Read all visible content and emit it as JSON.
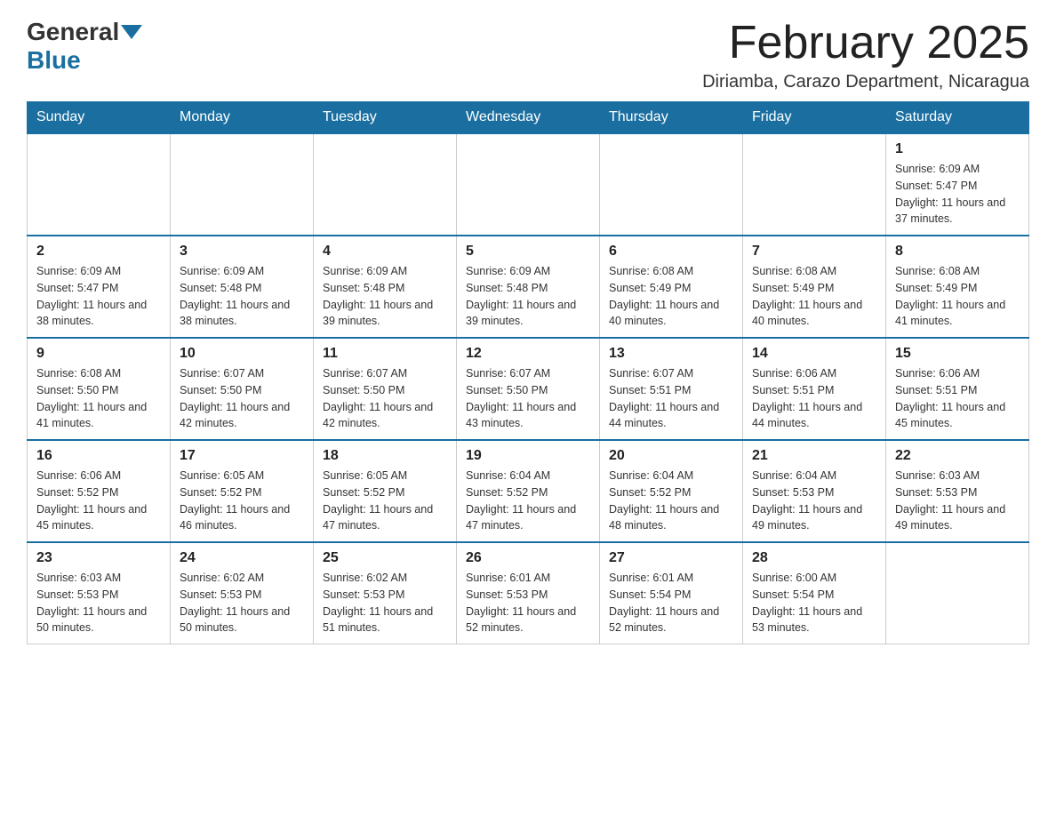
{
  "header": {
    "logo_general": "General",
    "logo_blue": "Blue",
    "month_title": "February 2025",
    "location": "Diriamba, Carazo Department, Nicaragua"
  },
  "days_of_week": [
    "Sunday",
    "Monday",
    "Tuesday",
    "Wednesday",
    "Thursday",
    "Friday",
    "Saturday"
  ],
  "weeks": [
    [
      {
        "day": "",
        "info": ""
      },
      {
        "day": "",
        "info": ""
      },
      {
        "day": "",
        "info": ""
      },
      {
        "day": "",
        "info": ""
      },
      {
        "day": "",
        "info": ""
      },
      {
        "day": "",
        "info": ""
      },
      {
        "day": "1",
        "info": "Sunrise: 6:09 AM\nSunset: 5:47 PM\nDaylight: 11 hours and 37 minutes."
      }
    ],
    [
      {
        "day": "2",
        "info": "Sunrise: 6:09 AM\nSunset: 5:47 PM\nDaylight: 11 hours and 38 minutes."
      },
      {
        "day": "3",
        "info": "Sunrise: 6:09 AM\nSunset: 5:48 PM\nDaylight: 11 hours and 38 minutes."
      },
      {
        "day": "4",
        "info": "Sunrise: 6:09 AM\nSunset: 5:48 PM\nDaylight: 11 hours and 39 minutes."
      },
      {
        "day": "5",
        "info": "Sunrise: 6:09 AM\nSunset: 5:48 PM\nDaylight: 11 hours and 39 minutes."
      },
      {
        "day": "6",
        "info": "Sunrise: 6:08 AM\nSunset: 5:49 PM\nDaylight: 11 hours and 40 minutes."
      },
      {
        "day": "7",
        "info": "Sunrise: 6:08 AM\nSunset: 5:49 PM\nDaylight: 11 hours and 40 minutes."
      },
      {
        "day": "8",
        "info": "Sunrise: 6:08 AM\nSunset: 5:49 PM\nDaylight: 11 hours and 41 minutes."
      }
    ],
    [
      {
        "day": "9",
        "info": "Sunrise: 6:08 AM\nSunset: 5:50 PM\nDaylight: 11 hours and 41 minutes."
      },
      {
        "day": "10",
        "info": "Sunrise: 6:07 AM\nSunset: 5:50 PM\nDaylight: 11 hours and 42 minutes."
      },
      {
        "day": "11",
        "info": "Sunrise: 6:07 AM\nSunset: 5:50 PM\nDaylight: 11 hours and 42 minutes."
      },
      {
        "day": "12",
        "info": "Sunrise: 6:07 AM\nSunset: 5:50 PM\nDaylight: 11 hours and 43 minutes."
      },
      {
        "day": "13",
        "info": "Sunrise: 6:07 AM\nSunset: 5:51 PM\nDaylight: 11 hours and 44 minutes."
      },
      {
        "day": "14",
        "info": "Sunrise: 6:06 AM\nSunset: 5:51 PM\nDaylight: 11 hours and 44 minutes."
      },
      {
        "day": "15",
        "info": "Sunrise: 6:06 AM\nSunset: 5:51 PM\nDaylight: 11 hours and 45 minutes."
      }
    ],
    [
      {
        "day": "16",
        "info": "Sunrise: 6:06 AM\nSunset: 5:52 PM\nDaylight: 11 hours and 45 minutes."
      },
      {
        "day": "17",
        "info": "Sunrise: 6:05 AM\nSunset: 5:52 PM\nDaylight: 11 hours and 46 minutes."
      },
      {
        "day": "18",
        "info": "Sunrise: 6:05 AM\nSunset: 5:52 PM\nDaylight: 11 hours and 47 minutes."
      },
      {
        "day": "19",
        "info": "Sunrise: 6:04 AM\nSunset: 5:52 PM\nDaylight: 11 hours and 47 minutes."
      },
      {
        "day": "20",
        "info": "Sunrise: 6:04 AM\nSunset: 5:52 PM\nDaylight: 11 hours and 48 minutes."
      },
      {
        "day": "21",
        "info": "Sunrise: 6:04 AM\nSunset: 5:53 PM\nDaylight: 11 hours and 49 minutes."
      },
      {
        "day": "22",
        "info": "Sunrise: 6:03 AM\nSunset: 5:53 PM\nDaylight: 11 hours and 49 minutes."
      }
    ],
    [
      {
        "day": "23",
        "info": "Sunrise: 6:03 AM\nSunset: 5:53 PM\nDaylight: 11 hours and 50 minutes."
      },
      {
        "day": "24",
        "info": "Sunrise: 6:02 AM\nSunset: 5:53 PM\nDaylight: 11 hours and 50 minutes."
      },
      {
        "day": "25",
        "info": "Sunrise: 6:02 AM\nSunset: 5:53 PM\nDaylight: 11 hours and 51 minutes."
      },
      {
        "day": "26",
        "info": "Sunrise: 6:01 AM\nSunset: 5:53 PM\nDaylight: 11 hours and 52 minutes."
      },
      {
        "day": "27",
        "info": "Sunrise: 6:01 AM\nSunset: 5:54 PM\nDaylight: 11 hours and 52 minutes."
      },
      {
        "day": "28",
        "info": "Sunrise: 6:00 AM\nSunset: 5:54 PM\nDaylight: 11 hours and 53 minutes."
      },
      {
        "day": "",
        "info": ""
      }
    ]
  ]
}
